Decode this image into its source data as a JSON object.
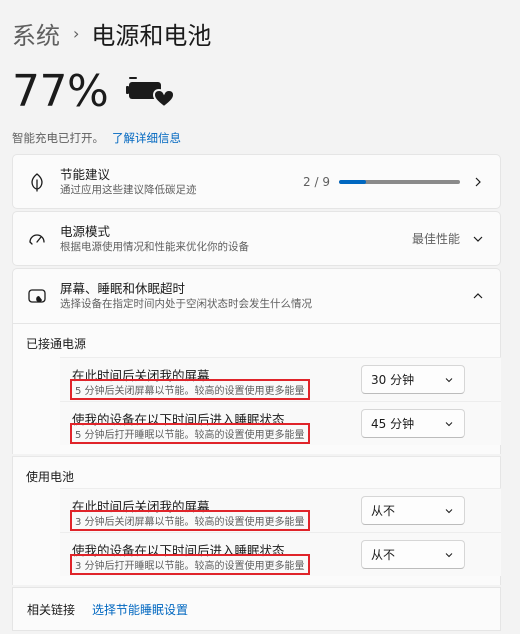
{
  "breadcrumb": {
    "parent": "系统",
    "separator": "›",
    "current": "电源和电池"
  },
  "battery": {
    "percent": "77%",
    "status": "智能充电已打开。",
    "learn_more": "了解详细信息"
  },
  "energy_tips": {
    "title": "节能建议",
    "desc": "通过应用这些建议降低碳足迹",
    "progress_label": "2 / 9",
    "progress": 0.222
  },
  "power_mode": {
    "title": "电源模式",
    "desc": "根据电源使用情况和性能来优化你的设备",
    "value": "最佳性能"
  },
  "screen_sleep": {
    "title": "屏幕、睡眠和休眠超时",
    "desc": "选择设备在指定时间内处于空闲状态时会发生什么情况",
    "plugged": {
      "label": "已接通电源",
      "rows": [
        {
          "title": "在此时间后关闭我的屏幕",
          "desc": "5 分钟后关闭屏幕以节能。较高的设置使用更多能量",
          "value": "30 分钟"
        },
        {
          "title": "使我的设备在以下时间后进入睡眠状态",
          "desc": "5 分钟后打开睡眠以节能。较高的设置使用更多能量",
          "value": "45 分钟"
        }
      ]
    },
    "battery": {
      "label": "使用电池",
      "rows": [
        {
          "title": "在此时间后关闭我的屏幕",
          "desc": "3 分钟后关闭屏幕以节能。较高的设置使用更多能量",
          "value": "从不"
        },
        {
          "title": "使我的设备在以下时间后进入睡眠状态",
          "desc": "3 分钟后打开睡眠以节能。较高的设置使用更多能量",
          "value": "从不"
        }
      ]
    }
  },
  "related": {
    "label": "相关链接",
    "link": "选择节能睡眠设置"
  },
  "colors": {
    "accent": "#0067c0",
    "highlight_border": "#e0242a"
  }
}
